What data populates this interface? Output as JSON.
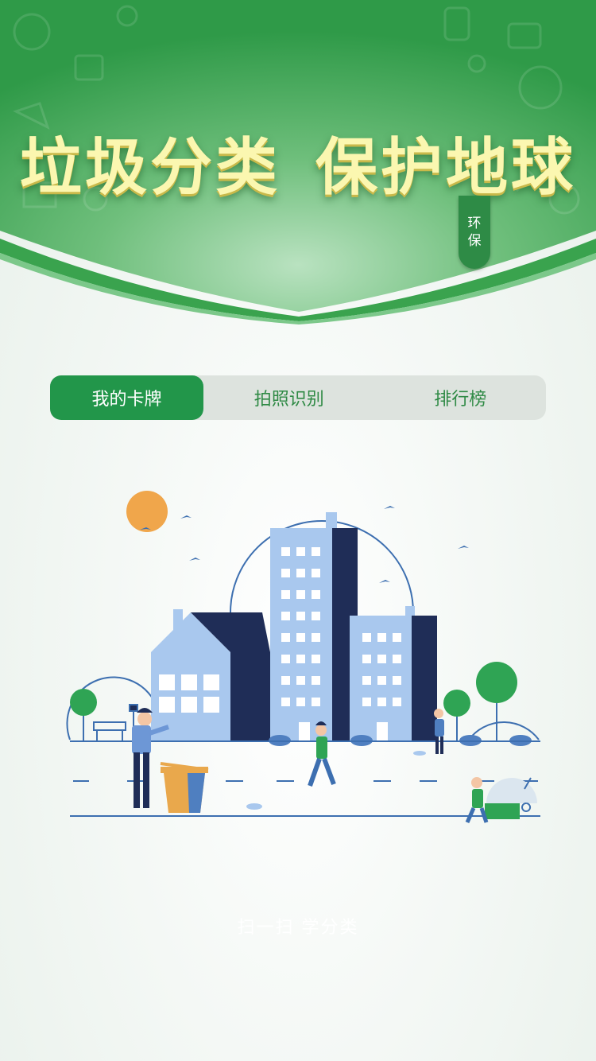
{
  "banner": {
    "title_left": "垃圾分类",
    "title_right": "保护地球",
    "bookmark_text": "环保"
  },
  "tabs": [
    {
      "label": "我的卡牌",
      "active": true
    },
    {
      "label": "拍照识别",
      "active": false
    },
    {
      "label": "排行榜",
      "active": false
    }
  ],
  "footer": {
    "scan_hint": "扫一扫   学分类"
  },
  "colors": {
    "primary_green": "#22964a",
    "banner_text": "#fbf7b0",
    "tab_inactive_text": "#2f8a45",
    "tab_track": "#dde3de"
  },
  "icons": [
    "sun-icon",
    "bird-icon",
    "tree-icon",
    "trash-bin-icon",
    "recycle-icon"
  ]
}
